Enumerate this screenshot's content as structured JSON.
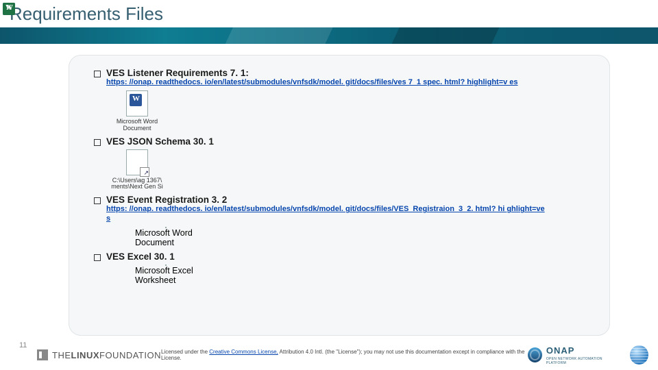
{
  "slide": {
    "title": "Requirements Files",
    "number": "11"
  },
  "items": [
    {
      "heading": "VES Listener Requirements 7. 1:",
      "link_text": "https: //onap. readthedocs. io/en/latest/submodules/vnfsdk/model. git/docs/files/ves 7_1 spec. html? highlight=v es",
      "embed_caption": "Microsoft Word\nDocument",
      "embed_kind": "word"
    },
    {
      "heading": "VES JSON Schema 30. 1",
      "embed_caption": "C:\\Users\\ag 1367\\\nments\\Next Gen Si",
      "embed_kind": "shortcut"
    },
    {
      "heading": "VES Event Registration 3. 2",
      "link_text": "https: //onap. readthedocs. io/en/latest/submodules/vnfsdk/model. git/docs/files/VES_Registraion_3_2. html? hi ghlight=ves",
      "embed_caption": "Microsoft Word\nDocument",
      "embed_kind": "word",
      "embed_offset": true
    },
    {
      "heading": "VES Excel 30. 1",
      "embed_caption": "Microsoft Excel\nWorksheet",
      "embed_kind": "excel",
      "embed_offset": true
    }
  ],
  "footer": {
    "linux_foundation": "THE LINUX FOUNDATION",
    "license_prefix": "Licensed under the ",
    "license_link": "Creative Commons License,",
    "license_suffix": " Attribution 4.0 Intl. (the \"License\"); you may not use this documentation except in compliance with the License.",
    "onap": "ONAP",
    "onap_sub": "OPEN NETWORK AUTOMATION PLATFORM"
  }
}
